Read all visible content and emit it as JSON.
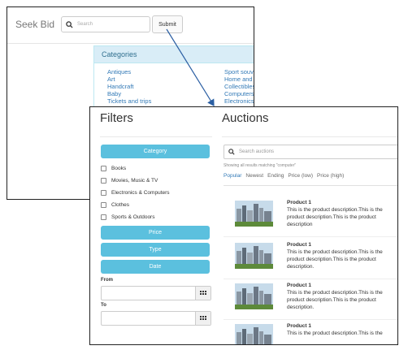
{
  "back_window": {
    "brand": "Seek Bid",
    "search_placeholder": "Search",
    "submit_label": "Submit",
    "categories_panel": {
      "title": "Categories",
      "col1": [
        "Antiques",
        "Art",
        "Handcraft",
        "Baby",
        "Tickets and trips"
      ],
      "col2": [
        "Sport souve",
        "Home and g",
        "Collectibles",
        "Computers",
        "Electronics"
      ]
    }
  },
  "front_window": {
    "filters_title": "Filters",
    "auctions_title": "Auctions",
    "category_button": "Category",
    "checkboxes": [
      "Books",
      "Movies, Music & TV",
      "Electronics & Computers",
      "Clothes",
      "Sports & Outdoors"
    ],
    "price_button": "Price",
    "type_button": "Type",
    "date_button": "Date",
    "from_label": "From",
    "to_label": "To",
    "search_placeholder": "Search auctions",
    "results_note": "Showing all results matching \"computer\"",
    "sort_tabs": [
      "Popular",
      "Newest",
      "Ending",
      "Price (low)",
      "Price (high)"
    ],
    "active_sort": "Popular",
    "items": [
      {
        "title": "Product 1",
        "description": "This is the product description.This is the product description.This is the product description"
      },
      {
        "title": "Product 1",
        "description": "This is the product description.This is the product description.This is the product description."
      },
      {
        "title": "Product 1",
        "description": "This is the product description.This is the product description.This is the product description."
      },
      {
        "title": "Product 1",
        "description": "This is the product description.This is the"
      }
    ]
  },
  "colors": {
    "accent_button": "#5bc0de",
    "link": "#337ab7",
    "panel_heading": "#d9edf7"
  }
}
